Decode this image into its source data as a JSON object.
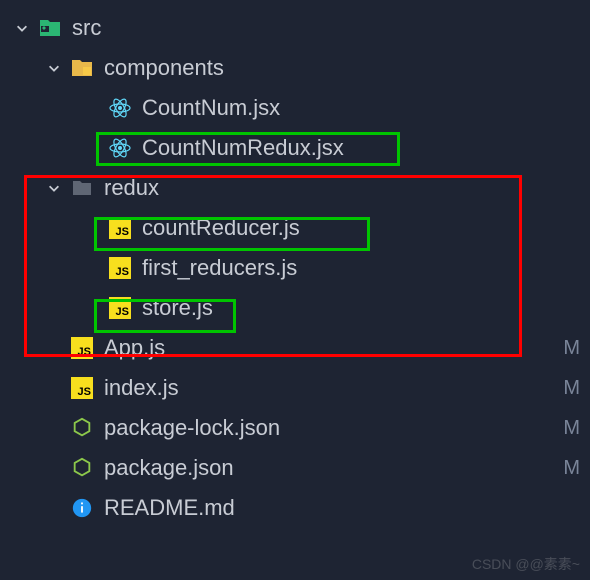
{
  "tree": {
    "src": {
      "label": "src",
      "expanded": true,
      "modified": true
    },
    "components": {
      "label": "components",
      "expanded": true
    },
    "countNum": {
      "label": "CountNum.jsx"
    },
    "countNumRedux": {
      "label": "CountNumRedux.jsx"
    },
    "redux": {
      "label": "redux",
      "expanded": true
    },
    "countReducer": {
      "label": "countReducer.js"
    },
    "firstReducers": {
      "label": "first_reducers.js"
    },
    "store": {
      "label": "store.js"
    },
    "app": {
      "label": "App.js",
      "status": "M"
    },
    "index": {
      "label": "index.js",
      "status": "M"
    },
    "packageLock": {
      "label": "package-lock.json",
      "status": "M"
    },
    "package": {
      "label": "package.json",
      "status": "M"
    },
    "readme": {
      "label": "README.md"
    }
  },
  "watermark": "CSDN @@素素~"
}
